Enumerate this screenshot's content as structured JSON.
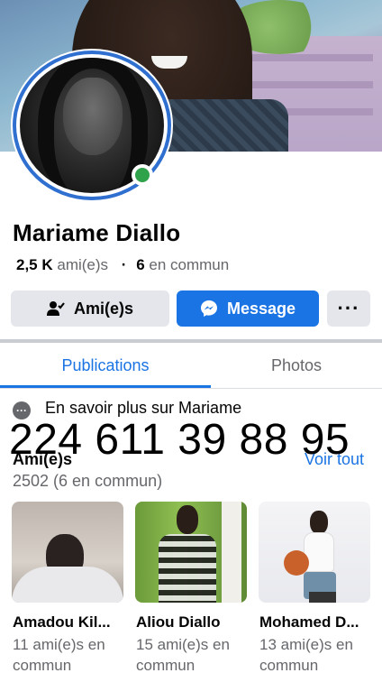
{
  "profile": {
    "name": "Mariame Diallo",
    "friends_count": "2,5 K",
    "friends_label": "ami(e)s",
    "mutual_count": "6",
    "mutual_label": "en commun",
    "online": true
  },
  "actions": {
    "friends_label": "Ami(e)s",
    "message_label": "Message",
    "more_label": "···"
  },
  "tabs": [
    {
      "label": "Publications",
      "active": true
    },
    {
      "label": "Photos",
      "active": false
    }
  ],
  "about": {
    "text": "En savoir plus sur Mariame"
  },
  "overlay": {
    "phone": "224 611 39 88 95"
  },
  "friends": {
    "title": "Ami(e)s",
    "see_all": "Voir tout",
    "subtitle": "2502 (6 en commun)",
    "items": [
      {
        "name": "Amadou Kil...",
        "mutual": "11 ami(e)s en commun"
      },
      {
        "name": "Aliou Diallo",
        "mutual": "15 ami(e)s en commun"
      },
      {
        "name": "Mohamed D...",
        "mutual": "13 ami(e)s en commun"
      }
    ]
  },
  "colors": {
    "accent": "#1b74e4",
    "online": "#31a24c",
    "button_gray": "#e4e6eb",
    "secondary_text": "#65676b"
  },
  "icons": {
    "friends_button": "person-check-icon",
    "message_button": "messenger-icon",
    "about": "more-dots-icon",
    "status": "online-dot-icon"
  }
}
